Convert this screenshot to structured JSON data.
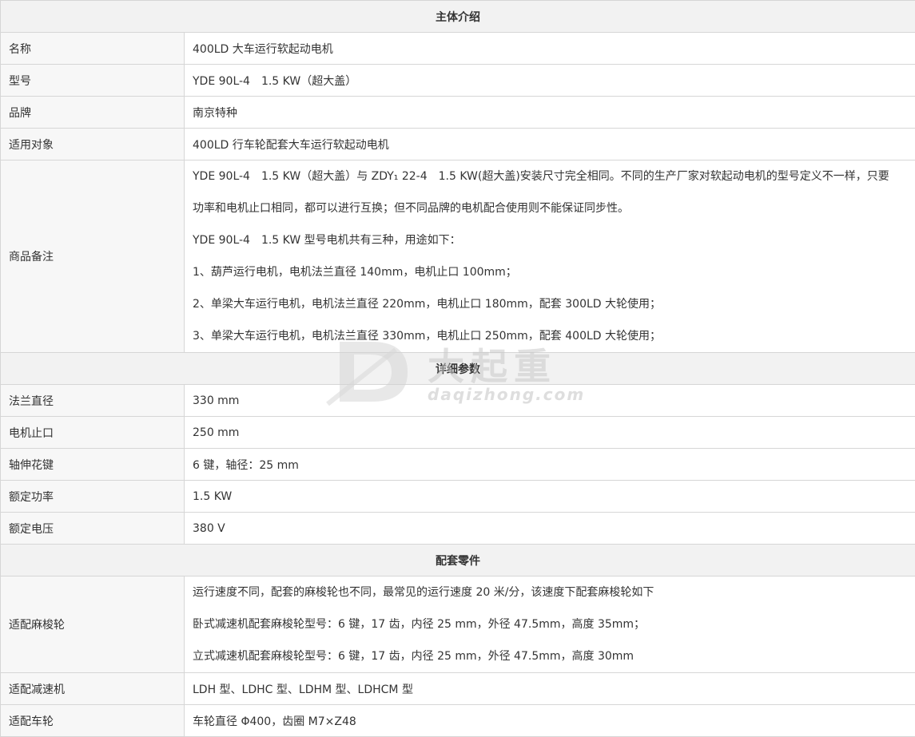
{
  "sections": {
    "main_intro": "主体介绍",
    "detail_params": "详细参数",
    "matching_parts": "配套零件"
  },
  "main": {
    "name_label": "名称",
    "name_value": "400LD 大车运行软起动电机",
    "model_label": "型号",
    "model_value": "YDE 90L-4　1.5 KW（超大盖）",
    "brand_label": "品牌",
    "brand_value": "南京特种",
    "applicable_label": "适用对象",
    "applicable_value": "400LD 行车轮配套大车运行软起动电机",
    "remarks_label": "商品备注",
    "remarks_lines": [
      "YDE 90L-4　1.5 KW（超大盖）与 ZDY₁ 22-4　1.5 KW(超大盖)安装尺寸完全相同。不同的生产厂家对软起动电机的型号定义不一样，只要",
      "功率和电机止口相同，都可以进行互换；但不同品牌的电机配合使用则不能保证同步性。",
      "YDE 90L-4　1.5 KW 型号电机共有三种，用途如下：",
      "1、葫芦运行电机，电机法兰直径 140mm，电机止口 100mm；",
      "2、单梁大车运行电机，电机法兰直径 220mm，电机止口 180mm，配套 300LD 大轮使用；",
      "3、单梁大车运行电机，电机法兰直径 330mm，电机止口 250mm，配套 400LD 大轮使用；"
    ]
  },
  "details": {
    "flange_label": "法兰直径",
    "flange_value": "330 mm",
    "spigot_label": "电机止口",
    "spigot_value": "250 mm",
    "spline_label": "轴伸花键",
    "spline_value": "6 键，轴径：25 mm",
    "power_label": "额定功率",
    "power_value": "1.5 KW",
    "voltage_label": "额定电压",
    "voltage_value": "380 V"
  },
  "parts": {
    "wheel_label": "适配麻梭轮",
    "wheel_lines": [
      "运行速度不同，配套的麻梭轮也不同，最常见的运行速度 20 米/分，该速度下配套麻梭轮如下",
      "卧式减速机配套麻梭轮型号：6 键，17 齿，内径 25 mm，外径 47.5mm，高度 35mm；",
      "立式减速机配套麻梭轮型号：6 键，17 齿，内径 25 mm，外径 47.5mm，高度 30mm"
    ],
    "reducer_label": "适配减速机",
    "reducer_value": "LDH 型、LDHC 型、LDHM 型、LDHCM 型",
    "carwheel_label": "适配车轮",
    "carwheel_value": "车轮直径 Φ400，齿圈 M7×Z48"
  },
  "watermark": {
    "text": "大起重",
    "url": "daqizhong.com"
  }
}
